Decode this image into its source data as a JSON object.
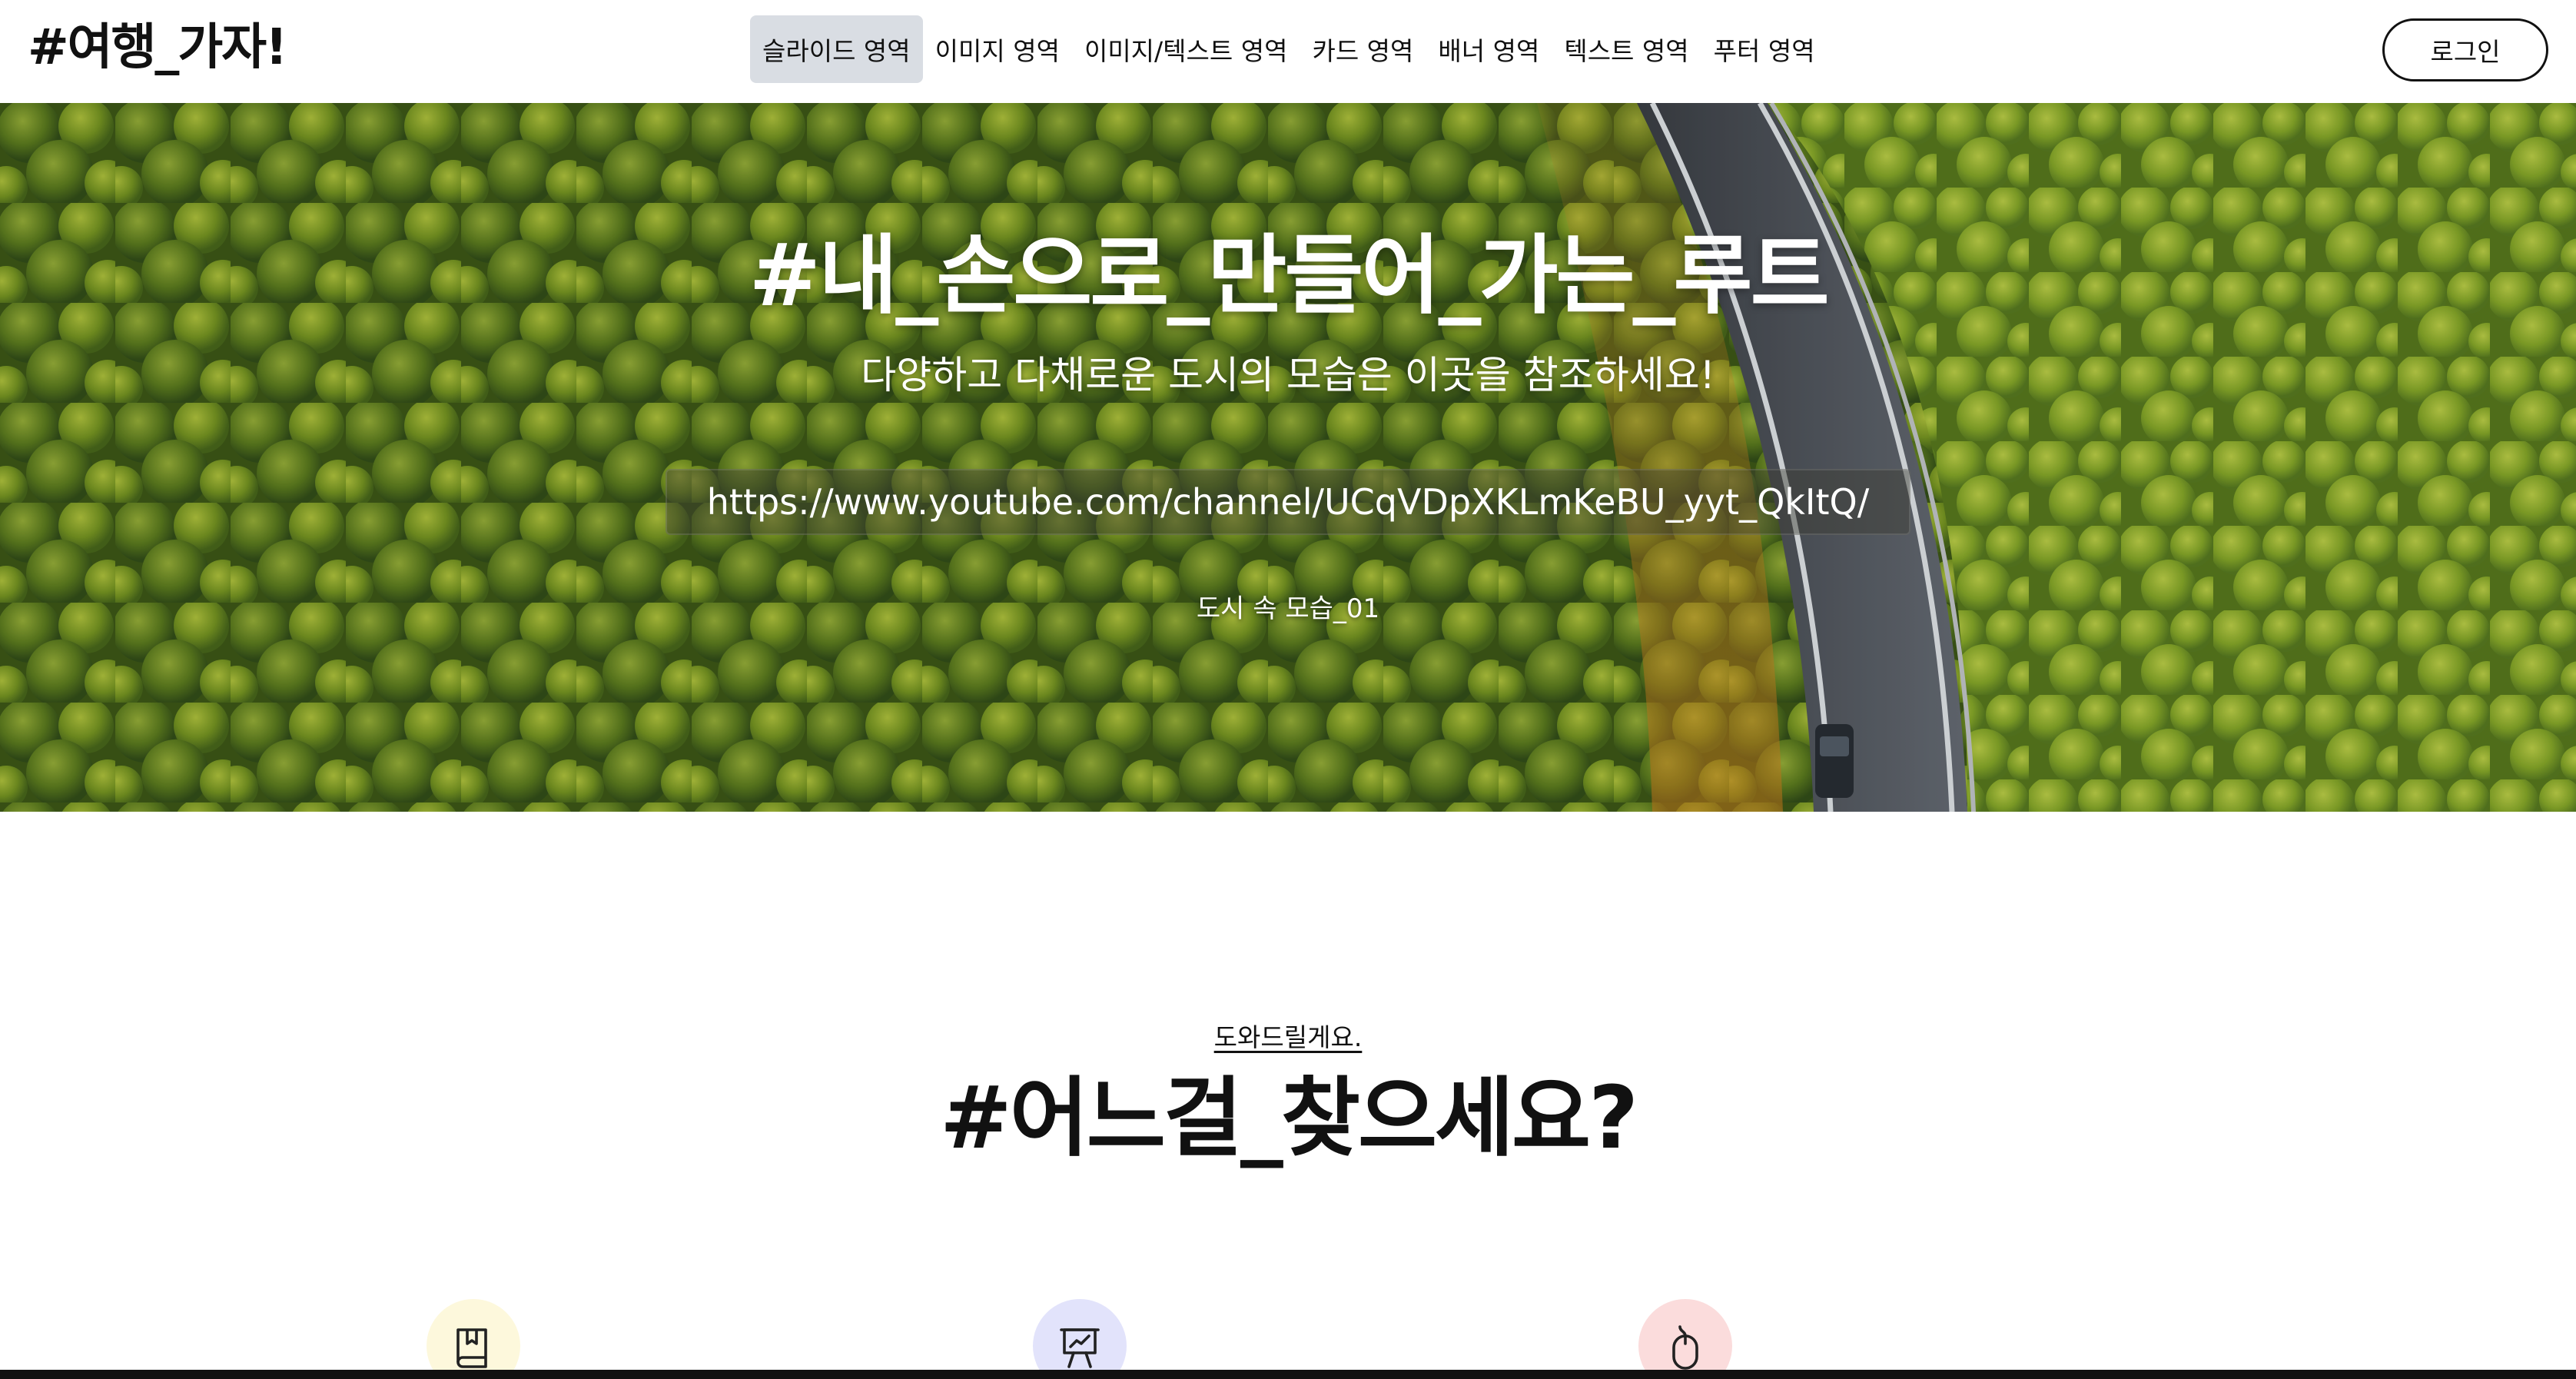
{
  "header": {
    "logo": "#여행_가자!",
    "nav": [
      {
        "label": "슬라이드 영역",
        "active": true
      },
      {
        "label": "이미지 영역",
        "active": false
      },
      {
        "label": "이미지/텍스트 영역",
        "active": false
      },
      {
        "label": "카드 영역",
        "active": false
      },
      {
        "label": "배너 영역",
        "active": false
      },
      {
        "label": "텍스트 영역",
        "active": false
      },
      {
        "label": "푸터 영역",
        "active": false
      }
    ],
    "login_label": "로그인"
  },
  "hero": {
    "title": "#내_손으로_만들어_가는_루트",
    "subtitle": "다양하고 다채로운 도시의 모습은 이곳을 참조하세요!",
    "url": "https://www.youtube.com/channel/UCqVDpXKLmKeBU_yyt_QkItQ/",
    "caption": "도시 속 모습_01"
  },
  "section": {
    "eyebrow": "도와드릴게요.",
    "title": "#어느걸_찾으세요?",
    "icons": [
      {
        "name": "book-icon",
        "color": "#fdf8dc"
      },
      {
        "name": "presentation-chart-icon",
        "color": "#e2e3fb"
      },
      {
        "name": "mouse-icon",
        "color": "#fbdcdc"
      }
    ]
  },
  "colors": {
    "text": "#111111",
    "active_nav_bg": "#d9dde3",
    "forest": "#4d6a1a"
  }
}
